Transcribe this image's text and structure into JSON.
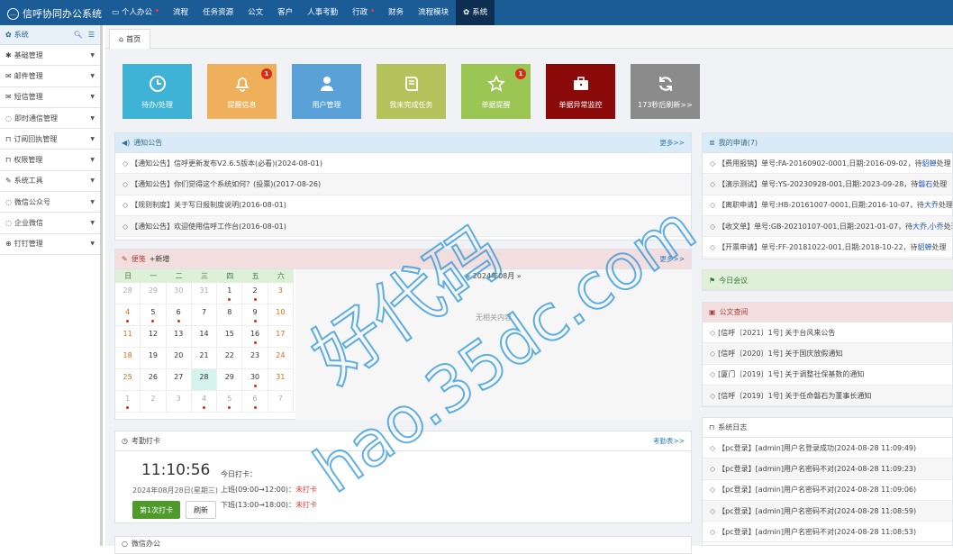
{
  "app": {
    "title": "信呼协同办公系统"
  },
  "nav": [
    {
      "label": "个人办公",
      "dot": true,
      "icon": "monitor-icon"
    },
    {
      "label": "流程"
    },
    {
      "label": "任务资源"
    },
    {
      "label": "公文"
    },
    {
      "label": "客户"
    },
    {
      "label": "人事考勤"
    },
    {
      "label": "行政",
      "dot": true
    },
    {
      "label": "财务"
    },
    {
      "label": "流程模块"
    },
    {
      "label": "系统",
      "icon": "gear-icon",
      "active": true
    }
  ],
  "sidebar": {
    "header": "系统",
    "items": [
      "基础管理",
      "邮件管理",
      "短信管理",
      "即时通信管理",
      "订阅回执管理",
      "权限管理",
      "系统工具",
      "微信公众号",
      "企业微信",
      "钉钉管理"
    ]
  },
  "tab": {
    "label": "首页"
  },
  "tiles": [
    {
      "label": "待办/处理",
      "color": "#3fb3d6"
    },
    {
      "label": "提醒信息",
      "color": "#efb05b",
      "badge": "1"
    },
    {
      "label": "用户管理",
      "color": "#5aa1d8"
    },
    {
      "label": "我未完成任务",
      "color": "#b5c25c"
    },
    {
      "label": "单据提醒",
      "color": "#9bc654",
      "badge": "1"
    },
    {
      "label": "单据异常监控",
      "color": "#8a0a0a"
    },
    {
      "label": "173秒后刷新>>",
      "color": "#8b8b8b"
    }
  ],
  "notice": {
    "title": "通知公告",
    "more": "更多>>",
    "rows": [
      "【通知公告】信呼更新发布V2.6.5版本(必看)(2024-08-01)",
      "【通知公告】你们觉得这个系统如何？(投票)(2017-08-26)",
      "【规则制度】关于写日报制度说明(2016-08-01)",
      "【通知公告】欢迎使用信呼工作台(2016-08-01)"
    ]
  },
  "schedule": {
    "title": "便笺",
    "add": "新增",
    "more": "更多>>",
    "month": "« 2024年08月 »",
    "empty": "无相关内容",
    "weekdays": [
      "日",
      "一",
      "二",
      "三",
      "四",
      "五",
      "六"
    ],
    "days": [
      {
        "d": "28",
        "o": 1
      },
      {
        "d": "29",
        "o": 1
      },
      {
        "d": "30",
        "o": 1
      },
      {
        "d": "31",
        "o": 1
      },
      {
        "d": "1",
        "e": 1
      },
      {
        "d": "2",
        "e": 1
      },
      {
        "d": "3",
        "r": 1
      },
      {
        "d": "4",
        "r": 1,
        "e": 1
      },
      {
        "d": "5",
        "e": 1
      },
      {
        "d": "6",
        "e": 1
      },
      {
        "d": "7"
      },
      {
        "d": "8"
      },
      {
        "d": "9",
        "e": 1
      },
      {
        "d": "10",
        "r": 1
      },
      {
        "d": "11",
        "r": 1
      },
      {
        "d": "12"
      },
      {
        "d": "13"
      },
      {
        "d": "14"
      },
      {
        "d": "15"
      },
      {
        "d": "16",
        "e": 1
      },
      {
        "d": "17",
        "r": 1
      },
      {
        "d": "18",
        "r": 1
      },
      {
        "d": "19"
      },
      {
        "d": "20"
      },
      {
        "d": "21"
      },
      {
        "d": "22"
      },
      {
        "d": "23"
      },
      {
        "d": "24",
        "r": 1
      },
      {
        "d": "25",
        "r": 1
      },
      {
        "d": "26"
      },
      {
        "d": "27"
      },
      {
        "d": "28",
        "t": 1
      },
      {
        "d": "29"
      },
      {
        "d": "30",
        "e": 1
      },
      {
        "d": "31",
        "r": 1
      },
      {
        "d": "1",
        "o": 1,
        "e": 1
      },
      {
        "d": "2",
        "o": 1
      },
      {
        "d": "3",
        "o": 1
      },
      {
        "d": "4",
        "o": 1,
        "e": 1
      },
      {
        "d": "5",
        "o": 1,
        "e": 1
      },
      {
        "d": "6",
        "o": 1,
        "e": 1
      },
      {
        "d": "7",
        "o": 1
      }
    ]
  },
  "attendance": {
    "title": "考勤打卡",
    "more": "考勤表>>",
    "time": "11:10:56",
    "date": "2024年08月28日(星期三)",
    "today": "今日打卡：",
    "am": "上班(09:00→12:00)：",
    "pm": "下班(13:00→18:00)：",
    "status": "未打卡",
    "punch": "第1次打卡",
    "refresh": "刷新"
  },
  "next_panel": {
    "title": "微信办公"
  },
  "apply": {
    "title": "我的申请(7)",
    "rows": [
      {
        "a": "【费用报销】单号:FA-20160902-0001,日期:2016-09-02，待",
        "n": "貂蝉",
        "b": "处理"
      },
      {
        "a": "【演示测试】单号:YS-20230928-001,日期:2023-09-28，待",
        "n": "磐石",
        "b": "处理"
      },
      {
        "a": "【离职申请】单号:HB-20161007-0001,日期:2016-10-07，待",
        "n": "大乔",
        "b": "处理"
      },
      {
        "a": "【收文单】单号:GB-20210107-001,日期:2021-01-07，待",
        "n": "大乔,小乔",
        "b": "处理"
      },
      {
        "a": "【开票申请】单号:FF-20181022-001,日期:2018-10-22，待",
        "n": "貂蝉",
        "b": "处理"
      }
    ]
  },
  "meeting": {
    "title": "今日会议"
  },
  "doc": {
    "title": "公文查阅",
    "rows": [
      "[信呼〔2021〕1号] 关于台风来公告",
      "[信呼〔2020〕1号] 关于国庆放假通知",
      "[厦门〔2019〕1号] 关于调整社保基数的通知",
      "[信呼〔2019〕1号] 关于任命磐石为董事长通知"
    ]
  },
  "syslog": {
    "title": "系统日志",
    "rows": [
      "【pc登录】[admin]用户名登录成功(2024-08-28 11:09:49)",
      "【pc登录】[admin]用户名密码不对(2024-08-28 11:09:23)",
      "【pc登录】[admin]用户名密码不对(2024-08-28 11:09:06)",
      "【pc登录】[admin]用户名密码不对(2024-08-28 11:08:59)",
      "【pc登录】[admin]用户名密码不对(2024-08-28 11:08:53)"
    ]
  },
  "watermark": {
    "line1": "好代码",
    "line2": "hao.35dc.com"
  }
}
